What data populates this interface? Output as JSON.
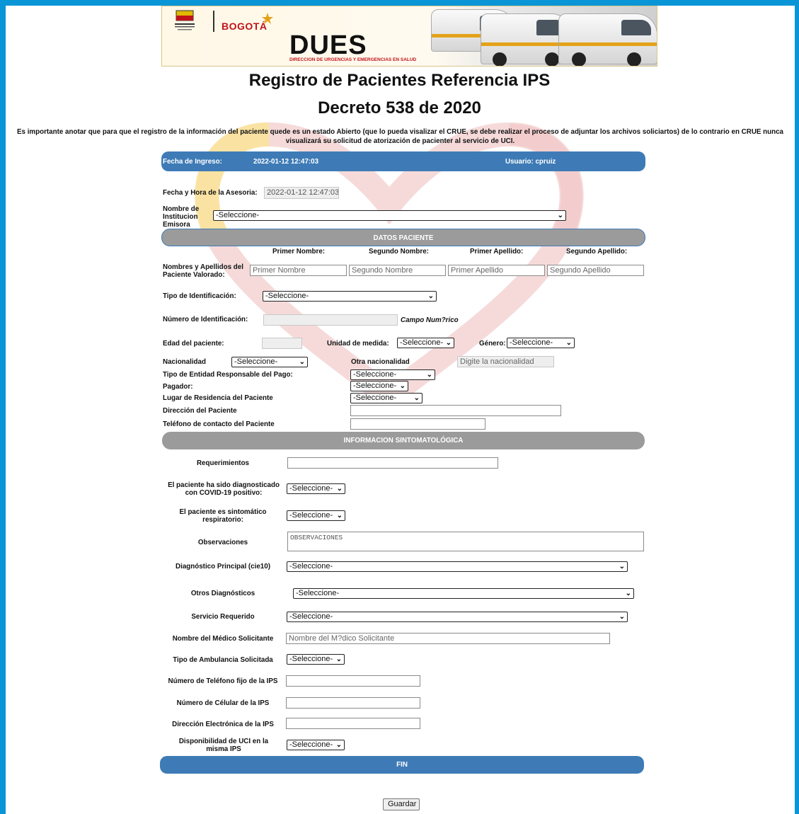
{
  "banner": {
    "brand_city": "BOGOTÁ",
    "brand_name": "DUES",
    "brand_subtitle": "DIRECCION DE URGENCIAS Y EMERGENCIAS EN SALUD"
  },
  "page": {
    "title": "Registro de Pacientes Referencia IPS",
    "subtitle": "Decreto 538 de 2020",
    "note": "Es importante anotar que para que el registro de la información del paciente quede es un estado Abierto (que lo pueda visalizar el CRUE, se debe realizar el proceso de adjuntar los archivos soliciartos) de lo contrario en CRUE nunca visualizará su solicitud de atorización de pacienter al servicio de UCI."
  },
  "header_bar": {
    "fecha_label": "Fecha de Ingreso:",
    "fecha_value": "2022-01-12 12:47:03",
    "usuario_label": "Usuario: cpruiz"
  },
  "asesoria": {
    "label": "Fecha y Hora de la Asesoria:",
    "value": "2022-01-12 12:47:03"
  },
  "institucion": {
    "label": "Nombre de Institucion Emisora",
    "value": "-Seleccione-"
  },
  "datos_paciente": {
    "section_title": "DATOS PACIENTE",
    "col_headers": [
      "Primer Nombre:",
      "Segundo Nombre:",
      "Primer Apellido:",
      "Segundo Apellido:"
    ],
    "names_label": "Nombres y Apellidos del Paciente Valorado:",
    "placeholders": [
      "Primer Nombre",
      "Segundo Nombre",
      "Primer Apellido",
      "Segundo Apellido"
    ],
    "tipo_id_label": "Tipo de Identificación:",
    "tipo_id_value": "-Seleccione-",
    "num_id_label": "Número de Identificación:",
    "num_id_hint": "Campo Num?rico",
    "edad_label": "Edad del paciente:",
    "unidad_label": "Unidad de medida:",
    "unidad_value": "-Seleccione-",
    "genero_label": "Género:",
    "genero_value": "-Seleccione-",
    "nacionalidad_label": "Nacionalidad",
    "nacionalidad_value": "-Seleccione-",
    "otra_nac_label": "Otra nacionalidad",
    "otra_nac_placeholder": "Digite la nacionalidad",
    "entidad_label": "Tipo de Entidad Responsable del Pago:",
    "entidad_value": "-Seleccione-",
    "pagador_label": "Pagador:",
    "pagador_value": "-Seleccione-",
    "residencia_label": "Lugar de Residencia del Paciente",
    "residencia_value": "-Seleccione-",
    "direccion_label": "Dirección del Paciente",
    "telefono_label": "Teléfono de contacto del Paciente"
  },
  "sintomas": {
    "section_title": "INFORMACION SINTOMATOLÓGICA",
    "requerimientos_label": "Requerimientos",
    "covid_label": "El paciente ha sido diagnosticado con COVID-19  positivo:",
    "covid_value": "-Seleccione-",
    "sintomatico_label": "El paciente es sintomático respiratorio:",
    "sintomatico_value": "-Seleccione-",
    "observaciones_label": "Observaciones",
    "observaciones_placeholder": "OBSERVACIONES",
    "diag_principal_label": "Diagnóstico Principal (cie10)",
    "diag_principal_value": "-Seleccione-",
    "otros_diag_label": "Otros Diagnósticos",
    "otros_diag_value": "-Seleccione-",
    "servicio_label": "Servicio Requerido",
    "servicio_value": "-Seleccione-",
    "medico_label": "Nombre del Médico Solicitante",
    "medico_placeholder": "Nombre del M?dico Solicitante",
    "ambulancia_label": "Tipo de Ambulancia Solicitada",
    "ambulancia_value": "-Seleccione-",
    "tel_fijo_label": "Número de Teléfono fijo de la IPS",
    "celular_label": "Número de Célular de la IPS",
    "email_label": "Dirección Electrónica de la IPS",
    "uci_label": "Disponibilidad de UCI en la misma IPS",
    "uci_value": "-Seleccione-"
  },
  "footer": {
    "fin_label": "FIN",
    "save_label": "Guardar"
  },
  "colors": {
    "frame": "#0a96d6",
    "bar_blue": "#3e7bb6",
    "bar_gray": "#9b9b9b"
  }
}
